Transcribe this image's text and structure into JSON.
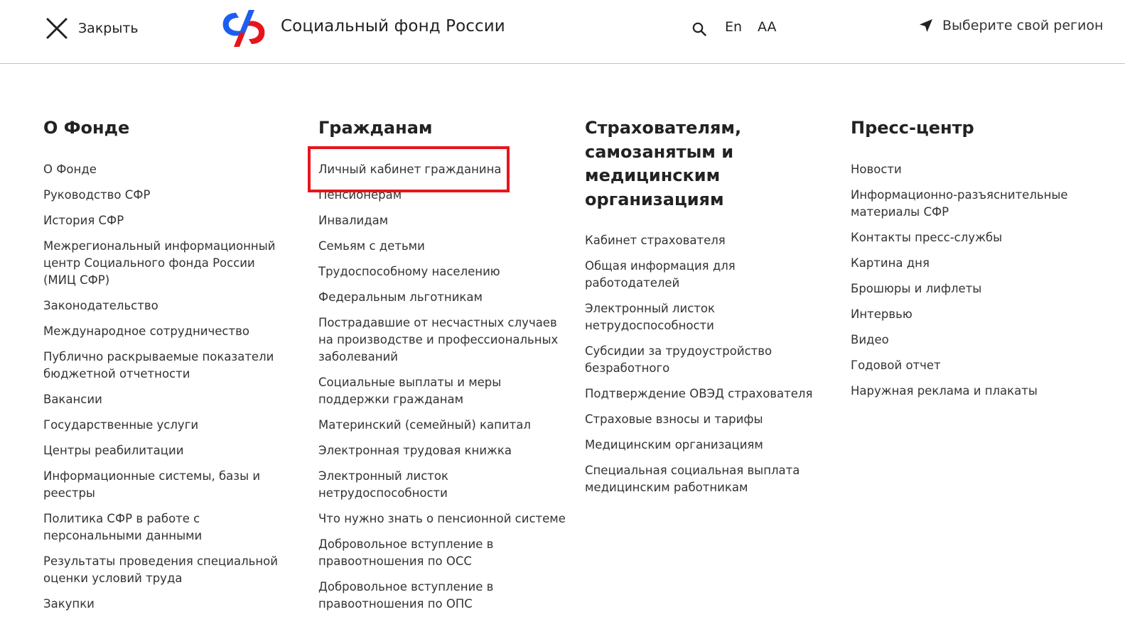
{
  "header": {
    "close_label": "Закрыть",
    "site_title": "Социальный фонд России",
    "lang_label": "En",
    "font_label": "AA",
    "region_label": "Выберите свой регион"
  },
  "colors": {
    "logo_blue": "#1c5ef2",
    "logo_red": "#e8141c",
    "highlight": "#e8141c",
    "divider": "#c4c4c4"
  },
  "icons": {
    "close": "close-icon",
    "logo": "sfr-logo",
    "search": "search-icon",
    "region": "location-arrow-icon"
  },
  "menu": {
    "fund": {
      "title": "О Фонде",
      "items": [
        "О Фонде",
        "Руководство СФР",
        "История СФР",
        "Межрегиональный информационный центр Социального фонда России (МИЦ СФР)",
        "Законодательство",
        "Международное сотрудничество",
        "Публично раскрываемые показатели бюджетной отчетности",
        "Вакансии",
        "Государственные услуги",
        "Центры реабилитации",
        "Информационные системы, базы и реестры",
        "Политика СФР в работе с персональными данными",
        "Результаты проведения специальной оценки условий труда",
        "Закупки"
      ]
    },
    "citizens": {
      "title": "Гражданам",
      "items": [
        "Личный кабинет гражданина",
        "Пенсионерам",
        "Инвалидам",
        "Семьям с детьми",
        "Трудоспособному населению",
        "Федеральным льготникам",
        "Пострадавшие от несчастных случаев на производстве и профессиональных заболеваний",
        "Социальные выплаты и меры поддержки гражданам",
        "Материнский (семейный) капитал",
        "Электронная трудовая книжка",
        "Электронный листок нетрудоспособности",
        "Что нужно знать о пенсионной системе",
        "Добровольное вступление в правоотношения по ОСС",
        "Добровольное вступление в правоотношения по ОПС"
      ]
    },
    "insurers": {
      "title": "Страхователям, самозанятым и медицинским организациям",
      "items": [
        "Кабинет страхователя",
        "Общая информация для работодателей",
        "Электронный листок нетрудоспособности",
        "Субсидии за трудоустройство безработного",
        "Подтверждение ОВЭД страхователя",
        "Страховые взносы и тарифы",
        "Медицинским организациям",
        "Специальная социальная выплата медицинским работникам"
      ]
    },
    "press": {
      "title": "Пресс-центр",
      "items": [
        "Новости",
        "Информационно-разъяснительные материалы СФР",
        "Контакты пресс-службы",
        "Картина дня",
        "Брошюры и лифлеты",
        "Интервью",
        "Видео",
        "Годовой отчет",
        "Наружная реклама и плакаты"
      ]
    }
  }
}
